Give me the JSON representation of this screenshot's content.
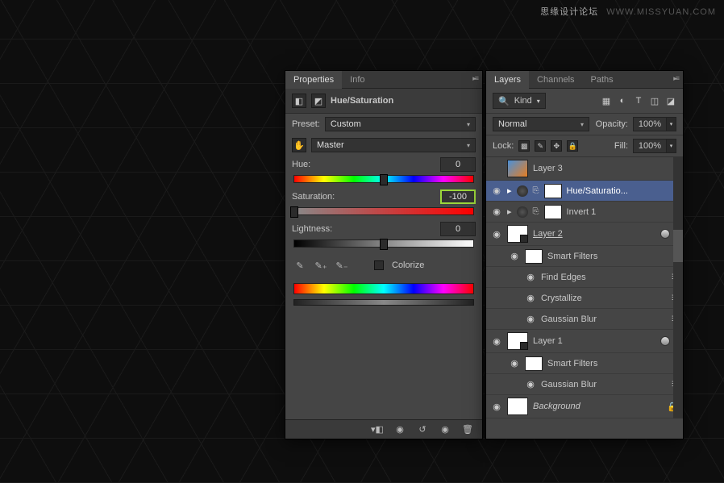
{
  "watermark": {
    "cn": "思缘设计论坛",
    "url": "WWW.MISSYUAN.COM"
  },
  "properties": {
    "tabs": [
      "Properties",
      "Info"
    ],
    "active_tab": 0,
    "title": "Hue/Saturation",
    "preset_label": "Preset:",
    "preset_value": "Custom",
    "range_value": "Master",
    "hue": {
      "label": "Hue:",
      "value": "0",
      "pos": 50
    },
    "sat": {
      "label": "Saturation:",
      "value": "-100",
      "pos": 0
    },
    "lig": {
      "label": "Lightness:",
      "value": "0",
      "pos": 50
    },
    "colorize_label": "Colorize",
    "footer_icons": [
      "clip",
      "view-prev",
      "reset",
      "view-next",
      "trash"
    ]
  },
  "layers": {
    "tabs": [
      "Layers",
      "Channels",
      "Paths"
    ],
    "active_tab": 0,
    "kind_label": "Kind",
    "filter_icons": [
      "▦",
      "◐",
      "T",
      "◫",
      "◪"
    ],
    "blend_mode": "Normal",
    "opacity_label": "Opacity:",
    "opacity_value": "100%",
    "lock_label": "Lock:",
    "fill_label": "Fill:",
    "fill_value": "100%",
    "items": [
      {
        "type": "layer",
        "visible": false,
        "label": "Layer 3",
        "thumb": "img"
      },
      {
        "type": "adjust",
        "visible": true,
        "label": "Hue/Saturatio...",
        "selected": true
      },
      {
        "type": "adjust",
        "visible": true,
        "label": "Invert 1"
      },
      {
        "type": "smart",
        "visible": true,
        "label": "Layer 2",
        "underline": true,
        "dot": true
      },
      {
        "type": "sf",
        "visible": true,
        "label": "Smart Filters",
        "indent": 1
      },
      {
        "type": "filter",
        "visible": true,
        "label": "Find Edges",
        "indent": 2,
        "fx": true
      },
      {
        "type": "filter",
        "visible": true,
        "label": "Crystallize",
        "indent": 2,
        "fx": true
      },
      {
        "type": "filter",
        "visible": true,
        "label": "Gaussian Blur",
        "indent": 2,
        "fx": true
      },
      {
        "type": "smart",
        "visible": true,
        "label": "Layer 1",
        "dot": true
      },
      {
        "type": "sf",
        "visible": true,
        "label": "Smart Filters",
        "indent": 1
      },
      {
        "type": "filter",
        "visible": true,
        "label": "Gaussian Blur",
        "indent": 2,
        "fx": true
      },
      {
        "type": "bg",
        "visible": true,
        "label": "Background",
        "lock": true
      }
    ]
  }
}
